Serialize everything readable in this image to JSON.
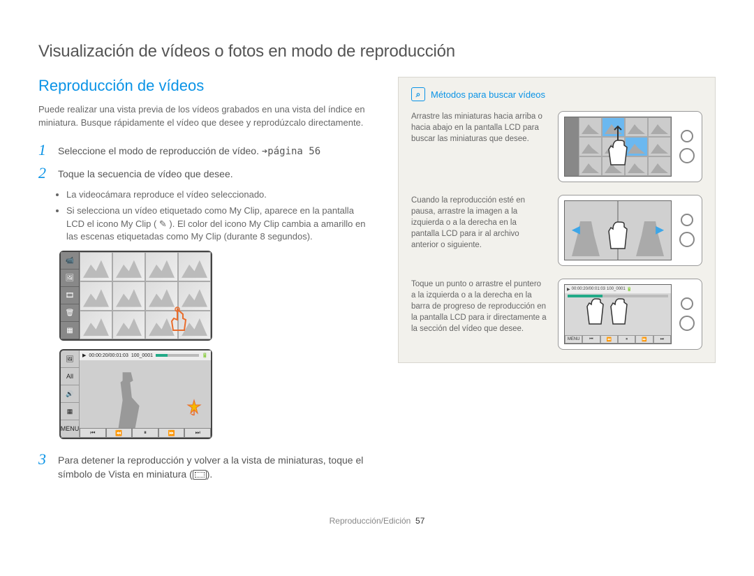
{
  "page": {
    "title": "Visualización de vídeos o fotos en modo de reproducción",
    "footer_section": "Reproducción/Edición",
    "footer_page": "57"
  },
  "left": {
    "section_title": "Reproducción de vídeos",
    "intro": "Puede realizar una vista previa de los vídeos grabados en una vista del índice en miniatura. Busque rápidamente el vídeo que desee y reprodúzcalo directamente.",
    "steps": [
      {
        "num": "1",
        "text_a": "Seleccione el modo de reproducción de vídeo. ",
        "page_ref": "➔página 56"
      },
      {
        "num": "2",
        "text_a": "Toque la secuencia de vídeo que desee."
      },
      {
        "num": "3",
        "text_a": "Para detener la reproducción y volver a la vista de miniaturas, toque el símbolo de Vista en miniatura (",
        "text_b": ")."
      }
    ],
    "bullets": [
      "La videocámara reproduce el vídeo seleccionado.",
      "Si selecciona un vídeo etiquetado como My Clip, aparece en la pantalla LCD el icono My Clip ( ✎ ). El color del icono My Clip cambia a amarillo en las escenas etiquetadas como My Clip (durante 8 segundos)."
    ],
    "player": {
      "time": "00:00:20/00:01:03",
      "clip": "100_0001",
      "menu": "MENU",
      "btn_prev": "⏮",
      "btn_rew": "⏪",
      "btn_pause": "⏸",
      "btn_fwd": "⏩",
      "btn_next": "⏭",
      "side_all": "All",
      "side_vol": "🔊",
      "side_thumb": "▦"
    }
  },
  "right": {
    "title": "Métodos para buscar vídeos",
    "methods": [
      "Arrastre las miniaturas hacia arriba o hacia abajo en la pantalla LCD para buscar las miniaturas que desee.",
      "Cuando la reproducción esté en pausa, arrastre la imagen a la izquierda o a la derecha en la pantalla LCD para ir al archivo anterior o siguiente.",
      "Toque un punto o arrastre el puntero a la izquierda o a la derecha en la barra de progreso de reproducción en la pantalla LCD para ir directamente a la sección del vídeo que desee."
    ],
    "device3": {
      "time": "00:00:20/00:01:03",
      "clip": "100_0001",
      "menu": "MENU"
    }
  }
}
